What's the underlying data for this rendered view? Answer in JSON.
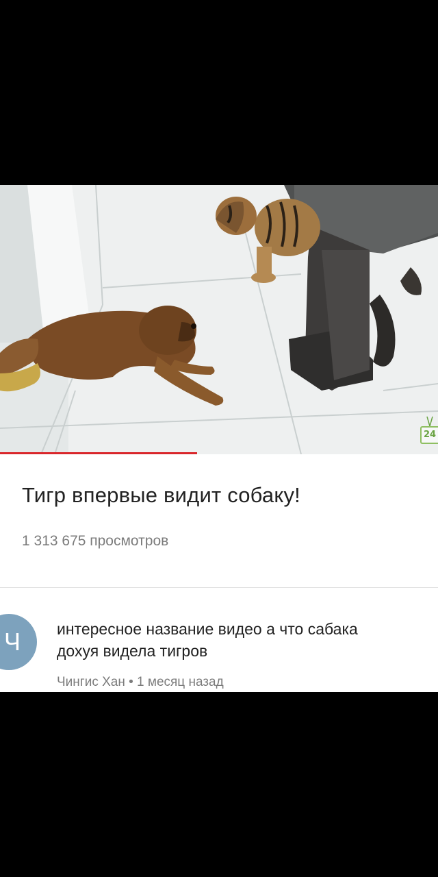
{
  "video": {
    "title": "Тигр впервые видит собаку!",
    "views": "1 313 675 просмотров",
    "progress": 0.45,
    "channel_logo_text": "24",
    "accent_color": "#d9262a"
  },
  "comment": {
    "avatar_letter": "Ч",
    "avatar_color": "#7da2bd",
    "text_line1": "интересное название видео а что сабака",
    "text_line2": "дохуя видела тигров",
    "meta": "Чингис Хан • 1 месяц назад"
  }
}
